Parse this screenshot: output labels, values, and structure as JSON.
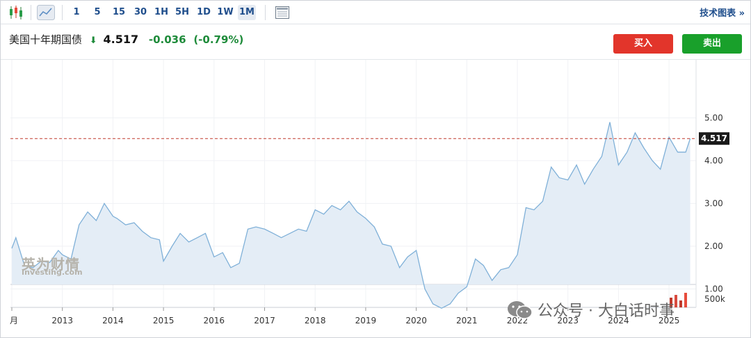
{
  "toolbar": {
    "intervals": [
      "1",
      "5",
      "15",
      "30",
      "1H",
      "5H",
      "1D",
      "1W",
      "1M"
    ],
    "active_interval": "1M",
    "tech_chart_label": "技术图表 »"
  },
  "instrument": {
    "name": "美国十年期国债",
    "price": "4.517",
    "change": "-0.036",
    "change_pct": "(-0.79%)",
    "direction": "down"
  },
  "actions": {
    "buy_label": "买入",
    "sell_label": "卖出"
  },
  "watermark": {
    "brand": "英为财情",
    "sub": "Investing.com"
  },
  "overlay_text": "公众号 · 大白话时事",
  "colors": {
    "line": "#7fb0d8",
    "fill": "#e4edf6",
    "price_line": "#c0392b",
    "up": "#1e8b3a",
    "buy": "#e2352b",
    "sell": "#19a02b"
  },
  "chart_data": {
    "type": "area",
    "current_value_label": "4.517",
    "current_value": 4.517,
    "y_ticks": [
      "5.00",
      "4.00",
      "3.00",
      "2.00",
      "1.00"
    ],
    "y_tick_values": [
      5,
      4,
      3,
      2,
      1
    ],
    "volume_label": "500k",
    "x_ticks": [
      "月",
      "2013",
      "2014",
      "2015",
      "2016",
      "2017",
      "2018",
      "2019",
      "2020",
      "2021",
      "2022",
      "2023",
      "2024",
      "2025"
    ],
    "x_tick_years": [
      2012.0,
      2013,
      2014,
      2015,
      2016,
      2017,
      2018,
      2019,
      2020,
      2021,
      2022,
      2023,
      2024,
      2025
    ],
    "ylim": [
      0.0,
      5.3
    ],
    "x": [
      2012.0,
      2012.08,
      2012.25,
      2012.42,
      2012.58,
      2012.75,
      2012.92,
      2013.0,
      2013.17,
      2013.33,
      2013.5,
      2013.67,
      2013.83,
      2014.0,
      2014.08,
      2014.25,
      2014.42,
      2014.58,
      2014.75,
      2014.92,
      2015.0,
      2015.17,
      2015.33,
      2015.5,
      2015.67,
      2015.83,
      2016.0,
      2016.17,
      2016.33,
      2016.5,
      2016.67,
      2016.83,
      2017.0,
      2017.17,
      2017.33,
      2017.5,
      2017.67,
      2017.83,
      2018.0,
      2018.17,
      2018.33,
      2018.5,
      2018.67,
      2018.83,
      2019.0,
      2019.17,
      2019.33,
      2019.5,
      2019.67,
      2019.83,
      2020.0,
      2020.17,
      2020.33,
      2020.5,
      2020.67,
      2020.83,
      2021.0,
      2021.17,
      2021.33,
      2021.5,
      2021.67,
      2021.83,
      2022.0,
      2022.17,
      2022.33,
      2022.5,
      2022.67,
      2022.83,
      2023.0,
      2023.17,
      2023.33,
      2023.5,
      2023.67,
      2023.83,
      2024.0,
      2024.17,
      2024.33,
      2024.5,
      2024.67,
      2024.83,
      2025.0,
      2025.17,
      2025.33,
      2025.42
    ],
    "values": [
      1.95,
      2.2,
      1.55,
      1.5,
      1.65,
      1.62,
      1.9,
      1.8,
      1.7,
      2.5,
      2.8,
      2.6,
      3.0,
      2.7,
      2.65,
      2.5,
      2.55,
      2.35,
      2.2,
      2.15,
      1.65,
      2.0,
      2.3,
      2.1,
      2.2,
      2.3,
      1.75,
      1.85,
      1.5,
      1.6,
      2.4,
      2.45,
      2.4,
      2.3,
      2.2,
      2.3,
      2.4,
      2.35,
      2.85,
      2.75,
      2.95,
      2.85,
      3.05,
      2.8,
      2.65,
      2.45,
      2.05,
      2.0,
      1.5,
      1.75,
      1.9,
      1.0,
      0.65,
      0.55,
      0.65,
      0.9,
      1.05,
      1.7,
      1.55,
      1.2,
      1.45,
      1.5,
      1.8,
      2.9,
      2.85,
      3.05,
      3.85,
      3.6,
      3.55,
      3.9,
      3.45,
      3.8,
      4.1,
      4.9,
      3.9,
      4.2,
      4.65,
      4.3,
      4.0,
      3.8,
      4.55,
      4.2,
      4.2,
      4.517
    ]
  }
}
